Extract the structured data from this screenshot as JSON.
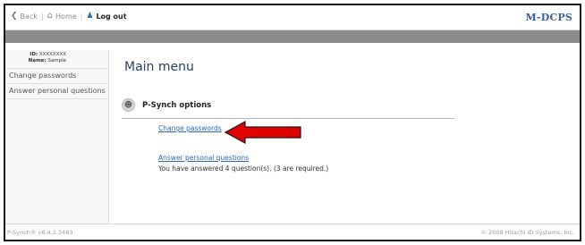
{
  "toolbar": {
    "back_label": "Back",
    "home_label": "Home",
    "logout_label": "Log out",
    "brand": "M-DCPS"
  },
  "sidebar": {
    "id_label": "ID:",
    "id_value": "XXXXXXXX",
    "name_label": "Name:",
    "name_value": "Sample",
    "items": [
      {
        "label": "Change passwords"
      },
      {
        "label": "Answer personal questions"
      }
    ]
  },
  "main": {
    "title": "Main menu",
    "section_title": "P-Synch options",
    "links": [
      {
        "label": "Change passwords"
      },
      {
        "label": "Answer personal questions"
      }
    ],
    "status": "You have answered 4 question(s). (3 are required.)"
  },
  "footer": {
    "version": "P-Synch® v6.4.2.3483",
    "copyright": "© 2008 Hitachi ID Systems, Inc."
  },
  "colors": {
    "arrow": "#e00000",
    "link": "#2a6ab8",
    "graybar": "#8d8d8d"
  },
  "icons": [
    "back-icon",
    "home-icon",
    "logout-icon",
    "user-avatar-icon",
    "red-arrow-annotation"
  ]
}
